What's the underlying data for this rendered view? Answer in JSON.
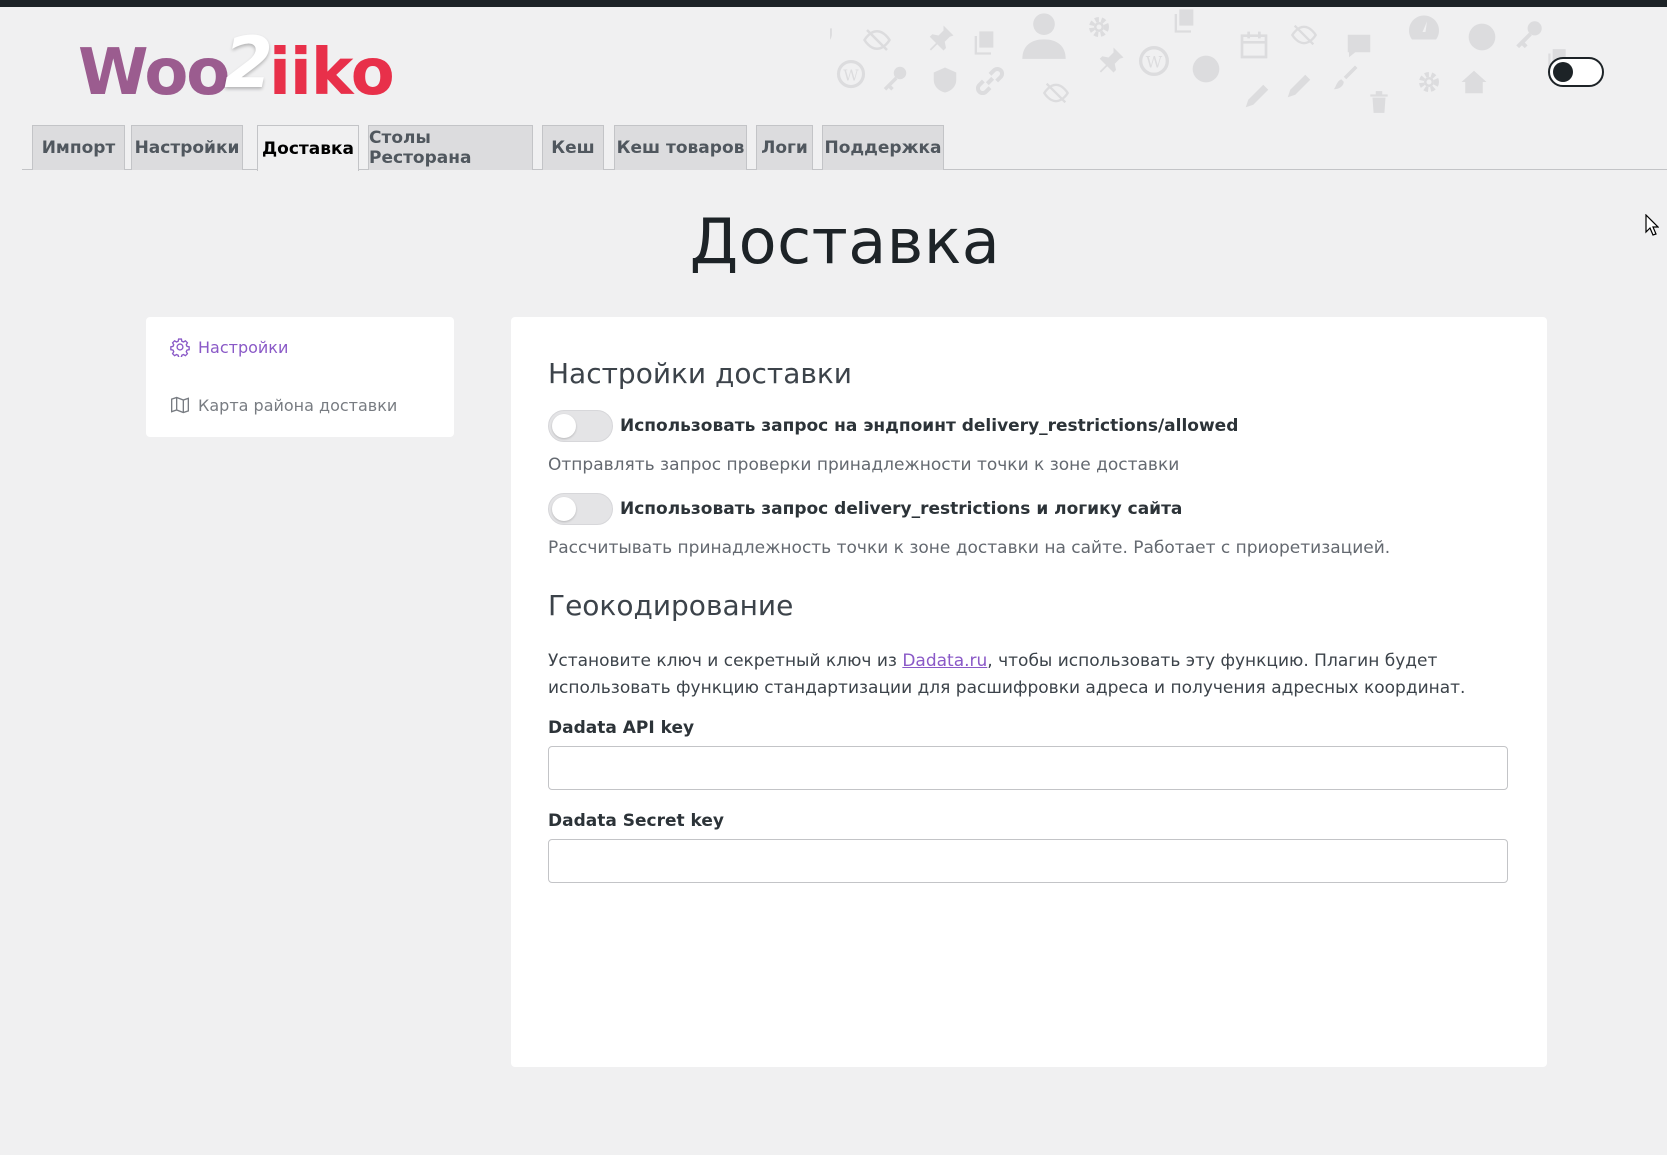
{
  "logo": {
    "woo": "Woo",
    "two": "2",
    "iiko": "iiko"
  },
  "tabs": [
    {
      "label": "Импорт",
      "active": false
    },
    {
      "label": "Настройки",
      "active": false
    },
    {
      "label": "Доставка",
      "active": true
    },
    {
      "label": "Столы Ресторана",
      "active": false
    },
    {
      "label": "Кеш",
      "active": false
    },
    {
      "label": "Кеш товаров",
      "active": false
    },
    {
      "label": "Логи",
      "active": false
    },
    {
      "label": "Поддержка",
      "active": false
    }
  ],
  "page": {
    "title": "Доставка"
  },
  "sidenav": {
    "items": [
      {
        "label": "Настройки",
        "icon": "gear-icon",
        "active": true
      },
      {
        "label": "Карта района доставки",
        "icon": "map-icon",
        "active": false
      }
    ]
  },
  "delivery": {
    "title": "Настройки доставки",
    "toggles": [
      {
        "label": "Использовать запрос на эндпоинт delivery_restrictions/allowed",
        "help": "Отправлять запрос проверки принадлежности точки к зоне доставки",
        "on": false
      },
      {
        "label": "Использовать запрос delivery_restrictions и логику сайта",
        "help": "Рассчитывать принадлежность точки к зоне доставки на сайте. Работает с приоретизацией.",
        "on": false
      }
    ]
  },
  "geocoding": {
    "title": "Геокодирование",
    "intro_before": "Установите ключ и секретный ключ из ",
    "link_text": "Dadata.ru",
    "intro_after": ", чтобы использовать эту функцию. Плагин будет использовать функцию стандартизации для расшифровки адреса и получения адресных координат.",
    "api_key_label": "Dadata API key",
    "api_key_value": "",
    "secret_key_label": "Dadata Secret key",
    "secret_key_value": ""
  },
  "theme_toggle": {
    "mode": "dark"
  },
  "colors": {
    "accent": "#8a59c7",
    "woo": "#9b5c8f",
    "iiko": "#e8304a"
  }
}
